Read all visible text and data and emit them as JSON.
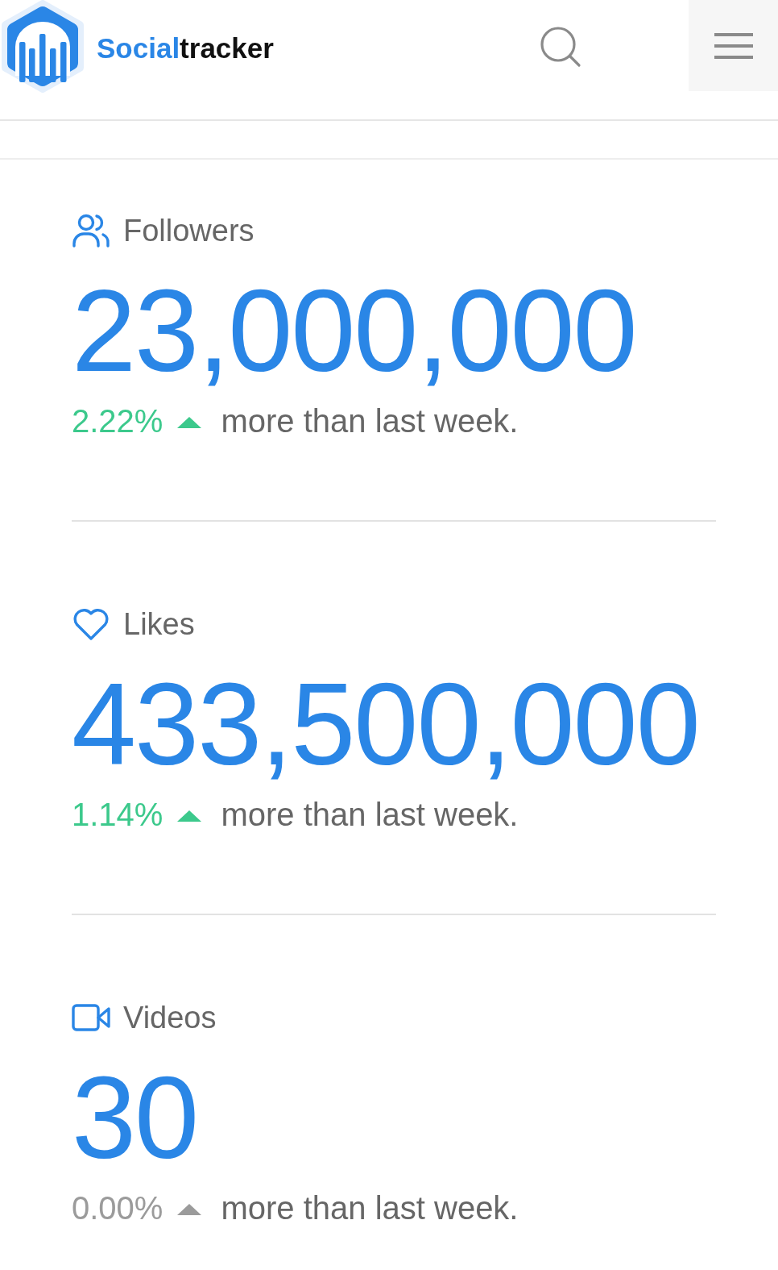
{
  "header": {
    "logo": {
      "text_accent": "Social",
      "text_rest": "tracker"
    }
  },
  "stats": [
    {
      "kind": "followers",
      "label": "Followers",
      "value": "23,000,000",
      "change": {
        "percent": "2.22%",
        "color": "#3cc98c",
        "text": "more than last week."
      }
    },
    {
      "kind": "likes",
      "label": "Likes",
      "value": "433,500,000",
      "change": {
        "percent": "1.14%",
        "color": "#3cc98c",
        "text": "more than last week."
      }
    },
    {
      "kind": "videos",
      "label": "Videos",
      "value": "30",
      "change": {
        "percent": "0.00%",
        "color": "#9b9b9b",
        "text": "more than last week."
      }
    }
  ]
}
